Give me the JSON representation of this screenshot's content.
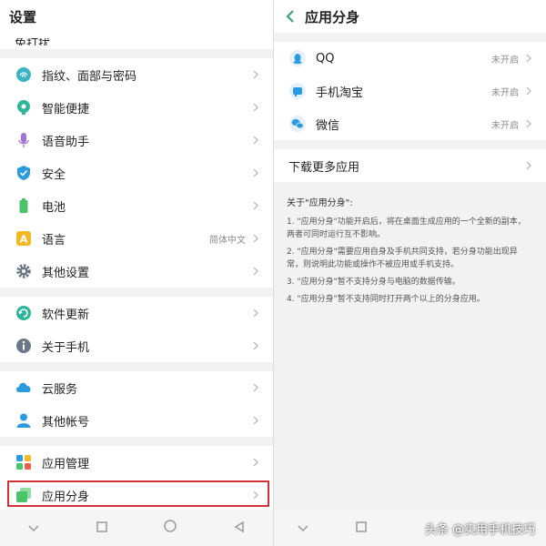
{
  "left": {
    "title": "设置",
    "partial_item": "免打扰",
    "groups": [
      [
        {
          "label": "指纹、面部与密码",
          "icon": "fingerprint-icon",
          "color": "#3ab3c7"
        },
        {
          "label": "智能便捷",
          "icon": "smart-assist-icon",
          "color": "#2fb59a"
        },
        {
          "label": "语音助手",
          "icon": "microphone-icon",
          "color": "#a46fd6"
        },
        {
          "label": "安全",
          "icon": "shield-icon",
          "color": "#2b9be0"
        },
        {
          "label": "电池",
          "icon": "battery-icon",
          "color": "#49c46a"
        },
        {
          "label": "语言",
          "value": "简体中文",
          "icon": "language-icon",
          "color": "#f4b825"
        },
        {
          "label": "其他设置",
          "icon": "gear-icon",
          "color": "#6b7787"
        }
      ],
      [
        {
          "label": "软件更新",
          "icon": "update-icon",
          "color": "#2fb59a"
        },
        {
          "label": "关于手机",
          "icon": "info-icon",
          "color": "#6b7787"
        }
      ],
      [
        {
          "label": "云服务",
          "icon": "cloud-icon",
          "color": "#2b9be0"
        },
        {
          "label": "其他帐号",
          "icon": "person-icon",
          "color": "#2b9be0"
        }
      ],
      [
        {
          "label": "应用管理",
          "icon": "apps-grid-icon",
          "color": "#2b9be0"
        },
        {
          "label": "应用分身",
          "icon": "app-clone-icon",
          "color": "#49c46a"
        }
      ]
    ]
  },
  "right": {
    "title": "应用分身",
    "apps": [
      {
        "label": "QQ",
        "status": "未开启",
        "icon": "qq-icon"
      },
      {
        "label": "手机淘宝",
        "status": "未开启",
        "icon": "taobao-icon"
      },
      {
        "label": "微信",
        "status": "未开启",
        "icon": "wechat-icon"
      }
    ],
    "download_more": "下载更多应用",
    "notes_title": "关于\"应用分身\":",
    "notes": [
      "1. \"应用分身\"功能开启后，将在桌面生成应用的一个全新的副本，两者可同时运行互不影响。",
      "2. \"应用分身\"需要应用自身及手机共同支持，若分身功能出现异常，则说明此功能或操作不被应用或手机支持。",
      "3. \"应用分身\"暂不支持分身与电脑的数据传输。",
      "4. \"应用分身\"暂不支持同时打开两个以上的分身应用。"
    ]
  },
  "watermark": "头条 @实用手机技巧",
  "colors": {
    "accent_green": "#3aa676",
    "highlight_red": "#d0323a"
  }
}
